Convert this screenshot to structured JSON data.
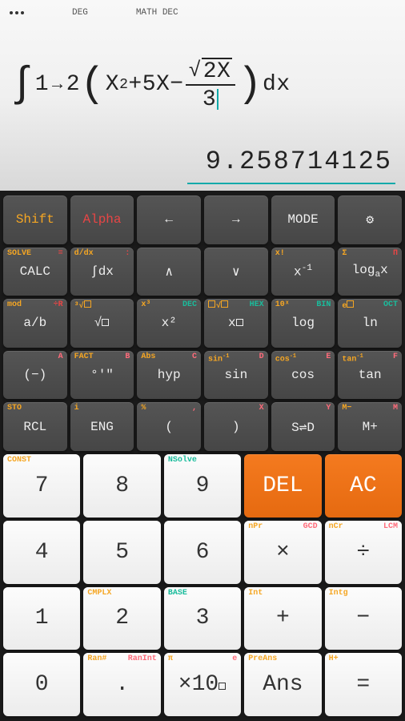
{
  "status": {
    "mode": "DEG",
    "format": "MATH DEC"
  },
  "expression": {
    "lower": "1",
    "upper": "2",
    "term1": "X",
    "exp1": "2",
    "term2": "+5X−",
    "sqrt_body": "2X",
    "denom": "3",
    "dx": "dx"
  },
  "result": "9.258714125",
  "rows": [
    [
      {
        "main": "Shift",
        "mainClass": "c-orange"
      },
      {
        "main": "Alpha",
        "mainClass": "c-red"
      },
      {
        "main": "←",
        "big": true
      },
      {
        "main": "→",
        "big": true
      },
      {
        "main": "MODE"
      },
      {
        "main": "⚙",
        "big": true,
        "name": "settings-icon"
      }
    ],
    [
      {
        "main": "CALC",
        "tl": "SOLVE",
        "tlc": "c-orange",
        "tr": "=",
        "trc": "c-red"
      },
      {
        "main": "∫dx",
        "tl": "d/dx",
        "tlc": "c-orange",
        "tr": ":",
        "trc": "c-red"
      },
      {
        "main": "∧",
        "big": true
      },
      {
        "main": "∨",
        "big": true
      },
      {
        "main": "x⁻¹",
        "tl": "x!",
        "tlc": "c-orange"
      },
      {
        "main": "logₐx",
        "tl": "Σ",
        "tlc": "c-orange",
        "tr": "Π",
        "trc": "c-red"
      }
    ],
    [
      {
        "main": "a/b",
        "tl": "mod",
        "tlc": "c-orange",
        "tr": "÷R",
        "trc": "c-red"
      },
      {
        "main": "√□",
        "tl": "³√□",
        "tlc": "c-orange"
      },
      {
        "main": "x²",
        "tl": "x³",
        "tlc": "c-orange",
        "tr": "DEC",
        "trc": "c-teal"
      },
      {
        "main": "x□",
        "tl": "□√□",
        "tlc": "c-orange",
        "tr": "HEX",
        "trc": "c-teal"
      },
      {
        "main": "log",
        "tl": "10ˣ",
        "tlc": "c-orange",
        "tr": "BIN",
        "trc": "c-teal"
      },
      {
        "main": "ln",
        "tl": "e□",
        "tlc": "c-orange",
        "tr": "OCT",
        "trc": "c-teal"
      }
    ],
    [
      {
        "main": "(−)",
        "tr": "A",
        "trc": "c-redpink"
      },
      {
        "main": "°'\"",
        "tl": "FACT",
        "tlc": "c-orange",
        "tr": "B",
        "trc": "c-redpink"
      },
      {
        "main": "hyp",
        "tl": "Abs",
        "tlc": "c-orange",
        "tr": "C",
        "trc": "c-redpink"
      },
      {
        "main": "sin",
        "tl": "sin⁻¹",
        "tlc": "c-orange",
        "tr": "D",
        "trc": "c-redpink"
      },
      {
        "main": "cos",
        "tl": "cos⁻¹",
        "tlc": "c-orange",
        "tr": "E",
        "trc": "c-redpink"
      },
      {
        "main": "tan",
        "tl": "tan⁻¹",
        "tlc": "c-orange",
        "tr": "F",
        "trc": "c-redpink"
      }
    ],
    [
      {
        "main": "RCL",
        "tl": "STO",
        "tlc": "c-orange"
      },
      {
        "main": "ENG",
        "tl": "i",
        "tlc": "c-orange"
      },
      {
        "main": "(",
        "tl": "%",
        "tlc": "c-orange",
        "tr": ",",
        "trc": "c-redpink"
      },
      {
        "main": ")",
        "tr": "X",
        "trc": "c-redpink"
      },
      {
        "main": "S⇌D",
        "tr": "Y",
        "trc": "c-redpink"
      },
      {
        "main": "M+",
        "tl": "M−",
        "tlc": "c-orange",
        "tr": "M",
        "trc": "c-redpink"
      }
    ]
  ],
  "numpad": [
    [
      {
        "main": "7",
        "tl": "CONST",
        "tlc": "c-orange",
        "style": "light"
      },
      {
        "main": "8",
        "style": "light"
      },
      {
        "main": "9",
        "tl": "NSolve",
        "tlc": "c-teal",
        "style": "light"
      },
      {
        "main": "DEL",
        "style": "orange"
      },
      {
        "main": "AC",
        "style": "orange"
      }
    ],
    [
      {
        "main": "4",
        "style": "light"
      },
      {
        "main": "5",
        "style": "light"
      },
      {
        "main": "6",
        "style": "light"
      },
      {
        "main": "×",
        "tl": "nPr",
        "tlc": "c-orange",
        "tr": "GCD",
        "trc": "c-redpink",
        "style": "light"
      },
      {
        "main": "÷",
        "tl": "nCr",
        "tlc": "c-orange",
        "tr": "LCM",
        "trc": "c-redpink",
        "style": "light"
      }
    ],
    [
      {
        "main": "1",
        "style": "light"
      },
      {
        "main": "2",
        "tl": "CMPLX",
        "tlc": "c-orange",
        "style": "light"
      },
      {
        "main": "3",
        "tl": "BASE",
        "tlc": "c-teal",
        "style": "light"
      },
      {
        "main": "+",
        "tl": "Int",
        "tlc": "c-orange",
        "style": "light"
      },
      {
        "main": "−",
        "tl": "Intg",
        "tlc": "c-orange",
        "style": "light"
      }
    ],
    [
      {
        "main": "0",
        "style": "light"
      },
      {
        "main": ".",
        "tl": "Ran#",
        "tlc": "c-orange",
        "tr": "RanInt",
        "trc": "c-redpink",
        "style": "light"
      },
      {
        "main": "×10□",
        "tl": "π",
        "tlc": "c-orange",
        "tr": "e",
        "trc": "c-redpink",
        "style": "light"
      },
      {
        "main": "Ans",
        "tl": "PreAns",
        "tlc": "c-orange",
        "style": "light"
      },
      {
        "main": "=",
        "tl": "H+",
        "tlc": "c-orange",
        "style": "light"
      }
    ]
  ]
}
